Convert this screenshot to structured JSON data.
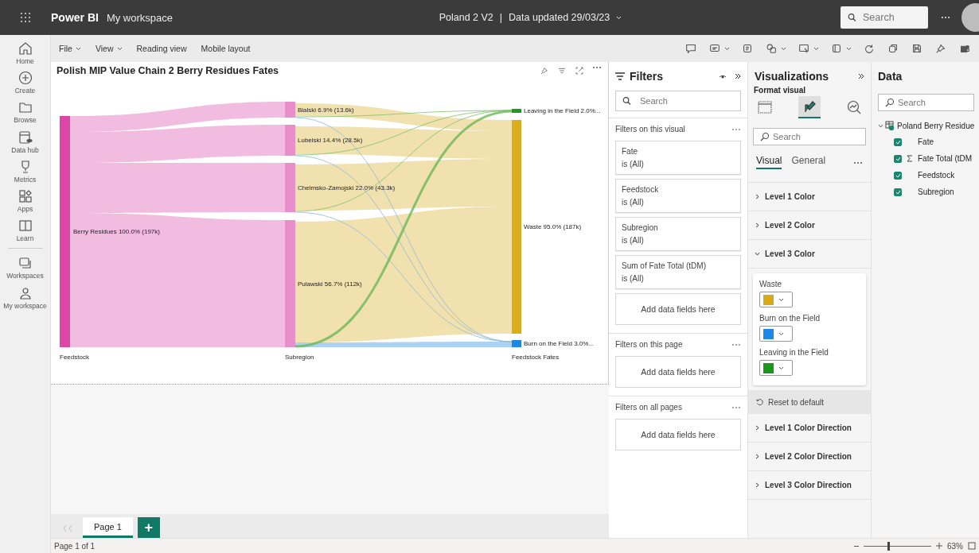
{
  "top_bar": {
    "app_name": "Power BI",
    "workspace": "My workspace",
    "report_name": "Poland 2 V2",
    "separator": "|",
    "data_updated": "Data updated 29/03/23",
    "search": {
      "placeholder": "Search"
    }
  },
  "nav": [
    {
      "label": "Home"
    },
    {
      "label": "Create"
    },
    {
      "label": "Browse"
    },
    {
      "label": "Data hub"
    },
    {
      "label": "Metrics"
    },
    {
      "label": "Apps"
    },
    {
      "label": "Learn"
    },
    {
      "label": "Workspaces"
    },
    {
      "label": "My workspace"
    }
  ],
  "toolbar": {
    "menus": [
      {
        "label": "File",
        "dropdown": true
      },
      {
        "label": "View",
        "dropdown": true
      },
      {
        "label": "Reading view",
        "dropdown": false
      },
      {
        "label": "Mobile layout",
        "dropdown": false
      }
    ]
  },
  "visual": {
    "title": "Polish MIP Value Chain 2 Berry Residues Fates",
    "nodes": [
      {
        "label": "Berry Residues 100.0% (197k)"
      },
      {
        "label": "Bialski 6.9% (13.6k)"
      },
      {
        "label": "Lubelski 14.4% (28.5k)"
      },
      {
        "label": "Chelmsko-Zamojski 22.0% (43.3k)"
      },
      {
        "label": "Pulawski 56.7% (112k)"
      },
      {
        "label": "Leaving in the Field 2.0%..."
      },
      {
        "label": "Waste 95.0% (187k)"
      },
      {
        "label": "Burn on the Field 3.0%..."
      }
    ],
    "columns": [
      "Feedstock",
      "Subregion",
      "Feedstock Fates"
    ]
  },
  "filters": {
    "title": "Filters",
    "search": {
      "placeholder": "Search"
    },
    "sections": [
      {
        "title": "Filters on this visual",
        "cards": [
          {
            "field": "Fate",
            "condition": "is (All)"
          },
          {
            "field": "Feedstock",
            "condition": "is (All)"
          },
          {
            "field": "Subregion",
            "condition": "is (All)"
          },
          {
            "field": "Sum of Fate Total (tDM)",
            "condition": "is (All)"
          }
        ],
        "drop_zone": "Add data fields here"
      },
      {
        "title": "Filters on this page",
        "drop_zone": "Add data fields here"
      },
      {
        "title": "Filters on all pages",
        "drop_zone": "Add data fields here"
      }
    ]
  },
  "visualizations": {
    "title": "Visualizations",
    "subtitle": "Format visual",
    "modes": [
      {
        "selected": false
      },
      {
        "selected": true
      },
      {
        "selected": false
      }
    ],
    "search": {
      "placeholder": "Search"
    },
    "tabs": [
      {
        "label": "Visual",
        "selected": true
      },
      {
        "label": "General",
        "selected": false
      }
    ],
    "sections": [
      {
        "label": "Level 1 Color",
        "expanded": false
      },
      {
        "label": "Level 2 Color",
        "expanded": false
      },
      {
        "label": "Level 3 Color",
        "expanded": true,
        "colors": [
          {
            "label": "Waste",
            "color": "#d8aa1a"
          },
          {
            "label": "Burn on the Field",
            "color": "#1e88e5"
          },
          {
            "label": "Leaving in the Field",
            "color": "#1a961a"
          }
        ],
        "reset": "Reset to default"
      },
      {
        "label": "Level 1 Color Direction",
        "expanded": false
      },
      {
        "label": "Level 2 Color Direction",
        "expanded": false
      },
      {
        "label": "Level 3 Color Direction",
        "expanded": false
      }
    ]
  },
  "data": {
    "title": "Data",
    "search": {
      "placeholder": "Search"
    },
    "tables": [
      {
        "name": "Poland Berry Residue",
        "expanded": true,
        "fields": [
          {
            "name": "Fate",
            "checked": true,
            "measure": false
          },
          {
            "name": "Fate Total (tDM",
            "checked": true,
            "measure": true
          },
          {
            "name": "Feedstock",
            "checked": true,
            "measure": false
          },
          {
            "name": "Subregion",
            "checked": true,
            "measure": false
          }
        ]
      }
    ]
  },
  "pages": [
    {
      "label": "Page 1",
      "selected": true
    }
  ],
  "add_page": "+",
  "status_bar": {
    "page_info": "Page 1 of 1",
    "zoom": "63%",
    "zoom_slider": {
      "level": 0.35
    }
  }
}
